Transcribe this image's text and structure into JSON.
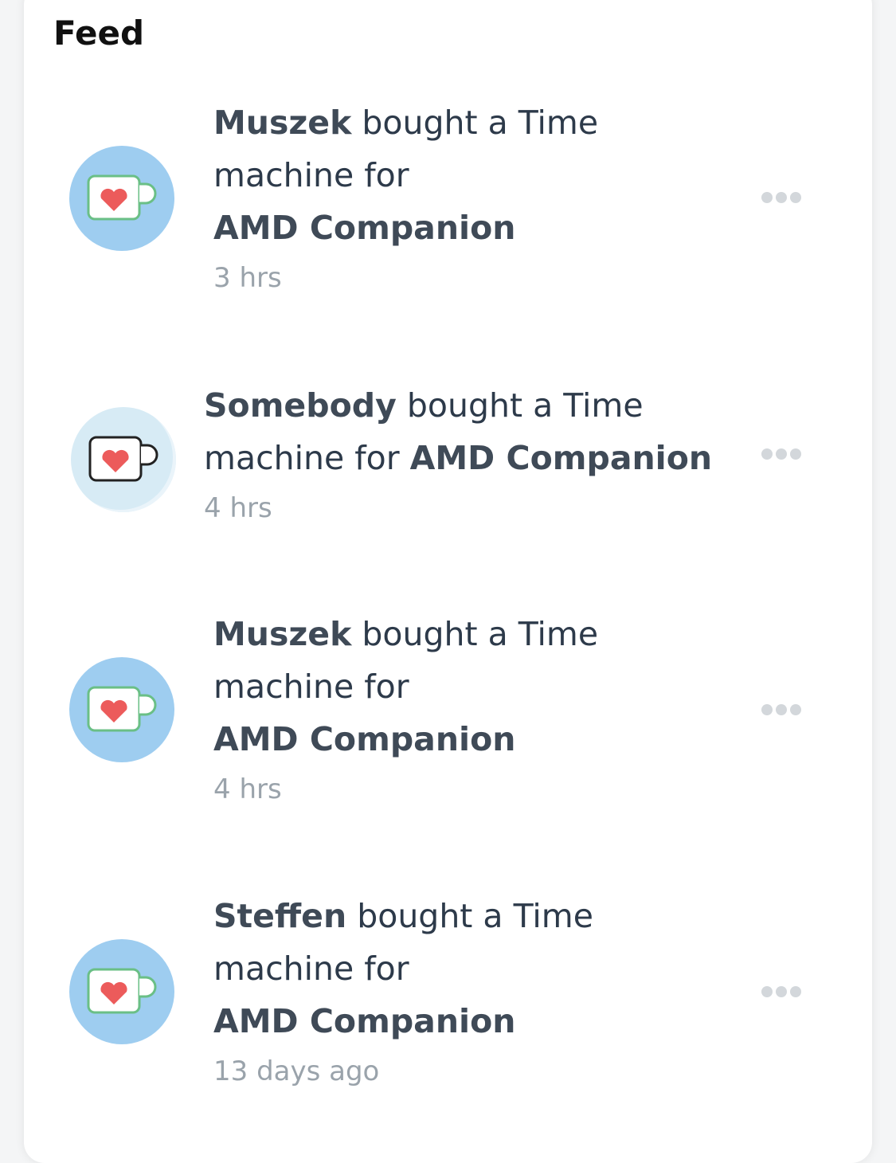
{
  "feed": {
    "title": "Feed",
    "items": [
      {
        "name": "Muszek",
        "action": "bought a Time",
        "action_cont": "machine for",
        "target": "AMD Companion",
        "time": "3 hrs",
        "avatar_icon": "kofi-cup-icon"
      },
      {
        "name": "Somebody",
        "action": "bought a Time",
        "action_cont": "machine for",
        "target": "AMD Companion",
        "time": "4 hrs",
        "avatar_icon": "kofi-cup-icon"
      },
      {
        "name": "Muszek",
        "action": "bought a Time",
        "action_cont": "machine for",
        "target": "AMD Companion",
        "time": "4 hrs",
        "avatar_icon": "kofi-cup-icon"
      },
      {
        "name": "Steffen",
        "action": "bought a Time",
        "action_cont": "machine for",
        "target": "AMD Companion",
        "time": "13 days ago",
        "avatar_icon": "kofi-cup-icon"
      }
    ]
  },
  "colors": {
    "avatar_bg": "#9ecdf0",
    "avatar_bg_anonymous": "#d7ebf5",
    "heart": "#ec5b5b",
    "cup_outline": "#6abf86",
    "text": "#2d3a4a",
    "muted": "#9aa3ab"
  }
}
